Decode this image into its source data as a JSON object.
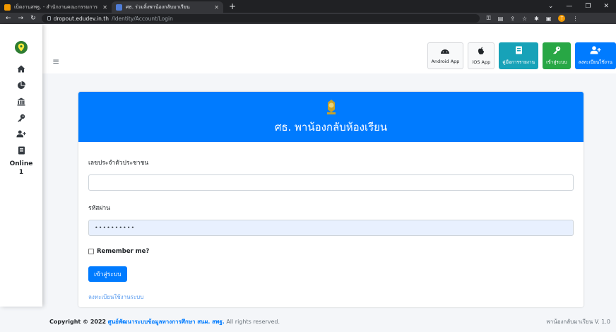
{
  "browser": {
    "tabs": [
      {
        "title": "เบ็ดงานสพฐ. - สำนักงานคณะกรรมการ",
        "active": false,
        "icon_color": "#f29900"
      },
      {
        "title": "ศธ. ร่วมลิ้งพาน้องกลับมาเรียน",
        "active": true,
        "icon_color": "#4f7dd8"
      }
    ],
    "url_host": "dropout.edudev.in.th",
    "url_path": "/Identity/Account/Login",
    "profile_initial": "T"
  },
  "sidebar": {
    "online_label": "Online",
    "online_count": "1",
    "icons": [
      "home-icon",
      "pie-chart-icon",
      "bank-icon",
      "key-icon",
      "user-plus-icon",
      "book-icon"
    ]
  },
  "topbar": {
    "buttons": [
      {
        "label": "Android App",
        "icon": "android-icon",
        "style": "light"
      },
      {
        "label": "iOS App",
        "icon": "apple-icon",
        "style": "light"
      },
      {
        "label": "คู่มือการรายงาน",
        "icon": "book-icon",
        "style": "teal"
      },
      {
        "label": "เข้าสู่ระบบ",
        "icon": "key-icon",
        "style": "green"
      },
      {
        "label": "ลงทะเบียนใช้งาน",
        "icon": "user-plus-icon",
        "style": "blue"
      }
    ]
  },
  "card": {
    "title": "ศธ. พาน้องกลับห้องเรียน",
    "id_label": "เลขประจำตัวประชาชน",
    "id_value": "",
    "password_label": "รหัสผ่าน",
    "password_value": "••••••••••",
    "remember_label": "Remember me?",
    "login_button": "เข้าสู่ระบบ",
    "register_link": "ลงทะเบียนใช้งานระบบ"
  },
  "footer": {
    "copyright_prefix": "Copyright © 2022",
    "org_link": "ศูนย์พัฒนาระบบข้อมูลทางการศึกษา สนผ. สพฐ.",
    "rights": "All rights reserved.",
    "version": "พาน้องกลับมาเรียน V. 1.0"
  },
  "colors": {
    "primary": "#007bff",
    "teal": "#17a2b8",
    "green": "#28a745"
  }
}
